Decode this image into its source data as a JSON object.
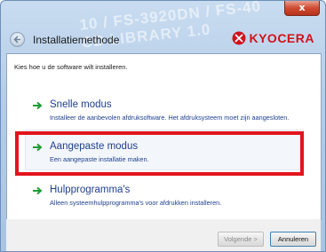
{
  "window": {
    "title": "Installatiemethode",
    "banner_text": "10 / FS-3920DN / FS-40\nCD LIBRARY 1.0",
    "close_label": "x"
  },
  "logo": {
    "text": "KYOCERA",
    "color": "#d2121b",
    "mark_icon": "kyocera-logo-icon"
  },
  "content": {
    "instruction": "Kies hoe u de software wilt installeren.",
    "options": [
      {
        "title": "Snelle modus",
        "description": "Installeer de aanbevolen afdruksoftware. Het afdruksysteem moet zijn aangesloten.",
        "icon": "green-arrow-icon"
      },
      {
        "title": "Aangepaste modus",
        "description": "Een aangepaste installatie maken.",
        "icon": "green-arrow-icon"
      },
      {
        "title": "Hulpprogramma's",
        "description": "Alleen systeemhulpprogramma's voor afdrukken installeren.",
        "icon": "green-arrow-icon"
      }
    ]
  },
  "buttons": {
    "next": "Volgende >",
    "cancel": "Annuleren"
  },
  "colors": {
    "link": "#1f3f8f",
    "arrow": "#1e9e34",
    "annotation": "#e3141c"
  }
}
